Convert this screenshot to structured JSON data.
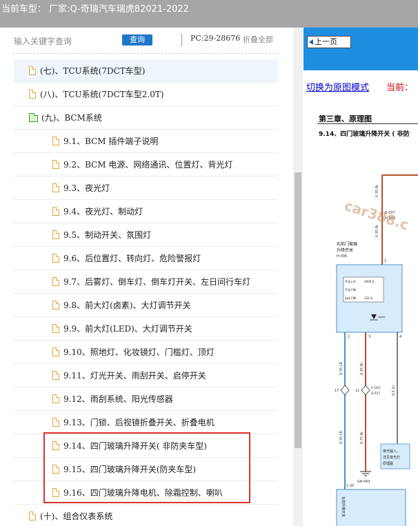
{
  "header": {
    "title": "当前车型： 厂家:Q-奇瑞汽车瑞虎82021-2022"
  },
  "search": {
    "placeholder": "输入关键字查询",
    "button_label": "查询",
    "pc_info": "PC:29-28676",
    "collapse_all": "折叠全部"
  },
  "tree": {
    "items": [
      {
        "label": "(七)、TCU系统(7DCT车型)"
      },
      {
        "label": "(八)、TCU系统(7DCT车型2.0T)"
      },
      {
        "label": "(九)、BCM系统"
      },
      {
        "label": "9.1、BCM 插件端子说明"
      },
      {
        "label": "9.2、BCM 电源、网络通讯、位置灯、背光灯"
      },
      {
        "label": "9.3、夜光灯"
      },
      {
        "label": "9.4、夜光灯、制动灯"
      },
      {
        "label": "9.5、制动开关、氛围灯"
      },
      {
        "label": "9.6、后位置灯、转向灯、危险警报灯"
      },
      {
        "label": "9.7、后雾灯、倒车灯、倒车灯开关、左日间行车灯"
      },
      {
        "label": "9.8、前大灯(卤素)、大灯调节开关"
      },
      {
        "label": "9.9、前大灯(LED)、大灯调节开关"
      },
      {
        "label": "9.10、照地灯、化妆镜灯、门槛灯、顶灯"
      },
      {
        "label": "9.11、灯光开关、雨刮开关、启停开关"
      },
      {
        "label": "9.12、雨刮系统、阳光传感器"
      },
      {
        "label": "9.13、门锁、后视镜折叠开关、折叠电机"
      },
      {
        "label": "9.14、四门玻璃升降开关( 非防夹车型)"
      },
      {
        "label": "9.15、四门玻璃升降开关(防夹车型)"
      },
      {
        "label": "9.16、四门玻璃升降电机、除霜控制、喇叭"
      },
      {
        "label": "(十)、组合仪表系统"
      }
    ]
  },
  "viewer": {
    "prev_page": "上一页",
    "switch_mode": "切换为原图模式",
    "current_label": "当前：",
    "chapter": "第三章、原理图",
    "section": "9.14、四门玻璃升降开关 ( 非防",
    "watermark": "car388.c",
    "diagram": {
      "connector_top_1": "B-037",
      "connector_top_2": "H-001",
      "switch_title_1": "右前门玻璃",
      "switch_title_2": "升降开关",
      "switch_code": "H-006",
      "pin_1": "1",
      "pin_2": "2",
      "pin_3": "3",
      "pin_4": "4",
      "row_up": "手动上升",
      "row_up_val": "3000 Ω",
      "row_down": "手动下降",
      "row_auto": "自动下降",
      "row_auto_val": "332 Ω",
      "wire_035_lr": "0.35 LR",
      "wire_035_br": "0.35 Br",
      "wire_05_gr": "0.5 Gr",
      "wire_035_lr_2": "0.35 LR",
      "wire_075_br": "0.75 Br",
      "wire_035_br_top": "0.35 Br",
      "wire_035_br_top2": "0.35 Br",
      "splice_left": "17",
      "splice_right": "11",
      "splice_code_1": "H-001",
      "splice_code_2": "B-037",
      "ground_code": "G8-043",
      "note_line_1": "夜光输入，",
      "note_line_2": "详见夜光灯",
      "note_line_3": "原理图",
      "bottom_pin": "1-20",
      "bottom_label": "车前升降开关"
    }
  },
  "colors": {
    "title_bar_bg": "#a6a6a6",
    "search_button": "#1f77c9",
    "nav_bar": "#1e8fe0",
    "highlight_border": "#d9342b",
    "wire_brown": "#b5502c",
    "wire_blue": "#4f8fd0",
    "switch_box_fill": "#d6ecfa"
  }
}
